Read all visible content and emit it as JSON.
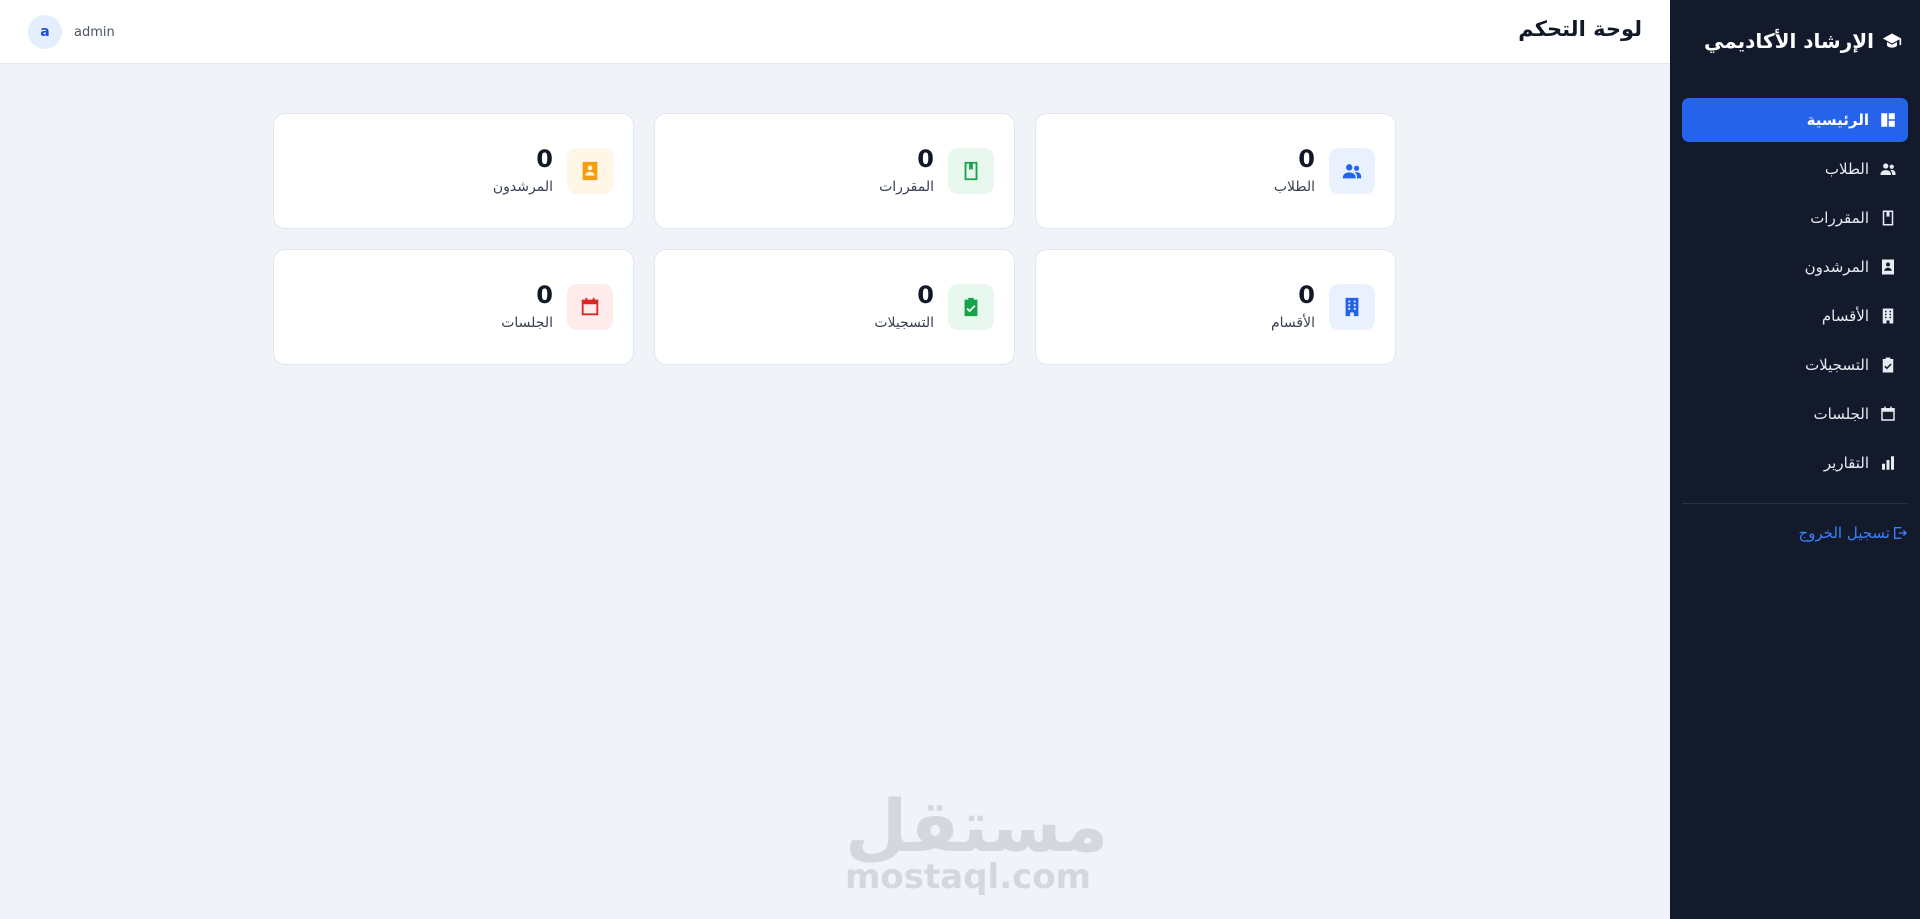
{
  "app": {
    "title": "الإرشاد الأكاديمي"
  },
  "header": {
    "title": "لوحة التحكم",
    "avatar_letter": "a",
    "username": "admin"
  },
  "sidebar": {
    "items": [
      {
        "label": "الرئيسية",
        "icon": "dashboard-icon",
        "active": true
      },
      {
        "label": "الطلاب",
        "icon": "users-icon",
        "active": false
      },
      {
        "label": "المقررات",
        "icon": "book-icon",
        "active": false
      },
      {
        "label": "المرشدون",
        "icon": "contact-card-icon",
        "active": false
      },
      {
        "label": "الأقسام",
        "icon": "building-icon",
        "active": false
      },
      {
        "label": "التسجيلات",
        "icon": "clipboard-check-icon",
        "active": false
      },
      {
        "label": "الجلسات",
        "icon": "calendar-icon",
        "active": false
      },
      {
        "label": "التقارير",
        "icon": "bar-chart-icon",
        "active": false
      }
    ],
    "logout_label": "تسجيل الخروج"
  },
  "stats": [
    {
      "label": "الطلاب",
      "value": "0",
      "icon": "users-icon",
      "color": "#2563eb",
      "bg": "#eaf1fe"
    },
    {
      "label": "المقررات",
      "value": "0",
      "icon": "book-icon",
      "color": "#16a34a",
      "bg": "#e8f8ee"
    },
    {
      "label": "المرشدون",
      "value": "0",
      "icon": "contact-card-icon",
      "color": "#f59e0b",
      "bg": "#fef6e7"
    },
    {
      "label": "الأقسام",
      "value": "0",
      "icon": "building-icon",
      "color": "#2563eb",
      "bg": "#eaf1fe"
    },
    {
      "label": "التسجيلات",
      "value": "0",
      "icon": "clipboard-check-icon",
      "color": "#16a34a",
      "bg": "#e8f8ee"
    },
    {
      "label": "الجلسات",
      "value": "0",
      "icon": "calendar-icon",
      "color": "#dc2626",
      "bg": "#fdeceb"
    }
  ],
  "watermark": {
    "arabic": "مستقل",
    "latin": "mostaql.com"
  },
  "colors": {
    "sidebar_bg": "#121a2c",
    "accent": "#2563eb",
    "page_bg": "#f0f3f8"
  }
}
